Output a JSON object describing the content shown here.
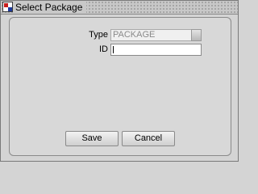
{
  "window": {
    "title": "Select Package",
    "icon": "oracle-forms-app-icon"
  },
  "form": {
    "type_label": "Type",
    "type_value": "PACKAGE",
    "id_label": "ID",
    "id_value": ""
  },
  "buttons": {
    "save_label": "Save",
    "cancel_label": "Cancel"
  }
}
